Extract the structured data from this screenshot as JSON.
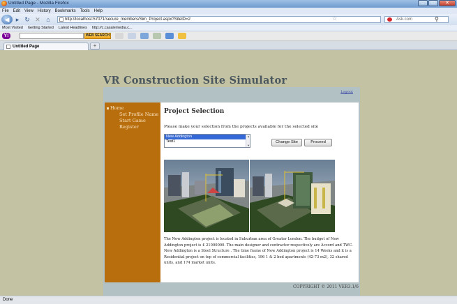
{
  "window": {
    "title": "Untitled Page - Mozilla Firefox"
  },
  "menu": [
    "File",
    "Edit",
    "View",
    "History",
    "Bookmarks",
    "Tools",
    "Help"
  ],
  "navigation": {
    "url": "http://localhost:57071/secure_members/Sim_Project.aspx?SiteID=2",
    "search_engine": "Ask.com"
  },
  "bookmarks": [
    "Most Visited",
    "Getting Started",
    "Latest Headlines",
    "http://c.casalemedia.c..."
  ],
  "yahoo_toolbar": {
    "logo": "Y!",
    "search_button": "WEB SEARCH"
  },
  "tabs": [
    {
      "label": "Untitled Page"
    }
  ],
  "new_tab_label": "+",
  "status": "Done",
  "page": {
    "site_title": "VR Construction Site Simulator",
    "logout": "Logout",
    "nav": [
      "Home",
      "Set Profile Name",
      "Start Game",
      "Register"
    ],
    "heading": "Project Selection",
    "instruction": "Please make your selection from the projects available for the selected site",
    "projects": [
      "New Addington",
      "Test1"
    ],
    "selected_project": "New Addington",
    "buttons": {
      "change_site": "Change Site",
      "proceed": "Proceed"
    },
    "description": "The New Addington project is located in Suburban area of Greater London. The budget of New Addington project is £ 21000000. The main designer and contractor respectively are Accord and TWC. New Addington is a Steel Structure . The time frame of New Addington project is 14 Weeks and it is a Residential project on top of commercial facilities, 196 1 & 2 bed apartments (42-73 m2), 32 shared units, and 174 market units.",
    "footer": "COPYRIGHT © 2011 VER3.1/6"
  }
}
